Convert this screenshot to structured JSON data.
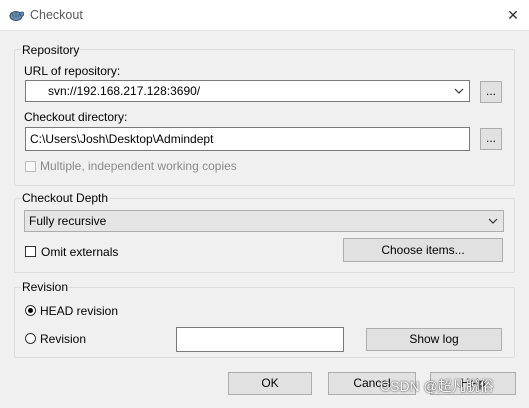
{
  "window": {
    "title": "Checkout",
    "close_glyph": "✕"
  },
  "repository": {
    "legend": "Repository",
    "url_label": "URL of repository:",
    "url_value": "svn://192.168.217.128:3690/",
    "url_browse": "...",
    "dir_label": "Checkout directory:",
    "dir_value": "C:\\Users\\Josh\\Desktop\\Admindept",
    "dir_browse": "...",
    "multiple_label": "Multiple, independent working copies",
    "multiple_checked": false,
    "multiple_enabled": false
  },
  "depth": {
    "legend": "Checkout Depth",
    "selected": "Fully recursive",
    "omit_label": "Omit externals",
    "omit_checked": false,
    "choose_items": "Choose items..."
  },
  "revision": {
    "legend": "Revision",
    "head_label": "HEAD revision",
    "revision_label": "Revision",
    "selected": "HEAD revision",
    "revision_value": "",
    "show_log": "Show log"
  },
  "buttons": {
    "ok": "OK",
    "cancel": "Cancel",
    "help": "Help"
  },
  "watermark": "CSDN @超凡脱俗",
  "icons": [
    "tortoise-svn-icon",
    "close-icon",
    "chevron-down-icon"
  ]
}
